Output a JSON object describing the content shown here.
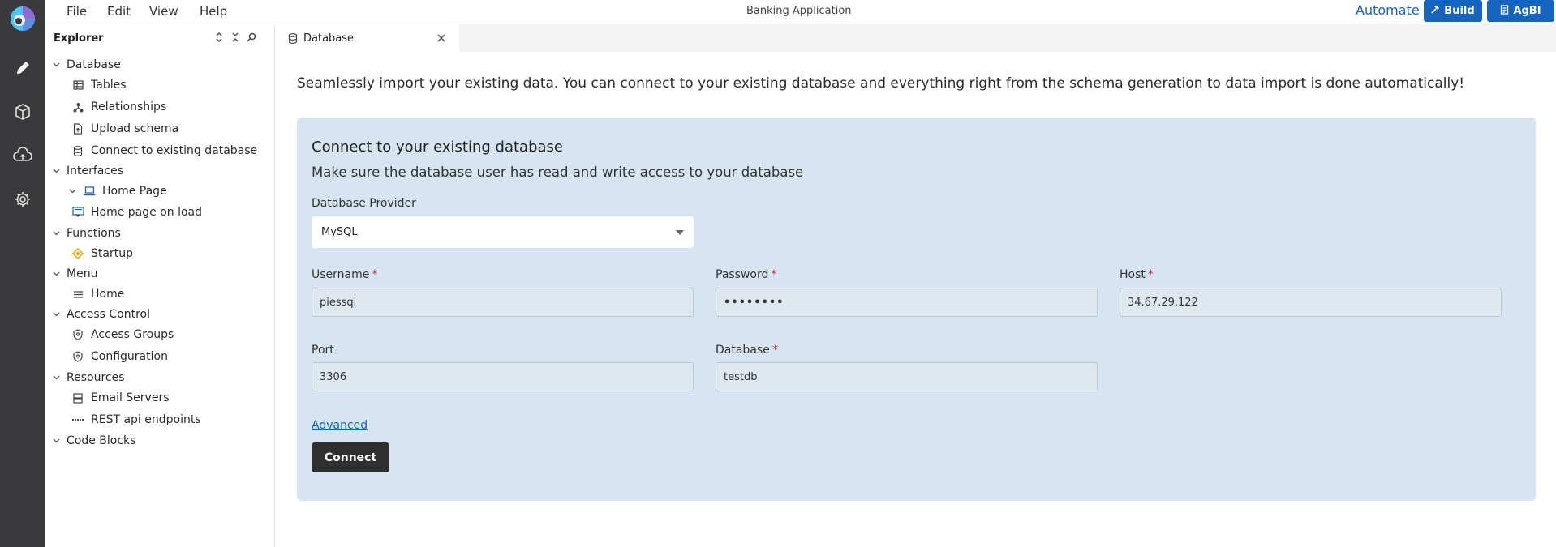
{
  "menu": {
    "file": "File",
    "edit": "Edit",
    "view": "View",
    "help": "Help",
    "app_title": "Banking Application",
    "automate": "Automate",
    "build": "Build",
    "agbi": "AgBI"
  },
  "explorer": {
    "title": "Explorer",
    "database": "Database",
    "tables": "Tables",
    "relationships": "Relationships",
    "upload_schema": "Upload schema",
    "connect_existing": "Connect to existing database",
    "interfaces": "Interfaces",
    "home_page": "Home Page",
    "home_page_on_load": "Home page on load",
    "functions": "Functions",
    "startup": "Startup",
    "menu": "Menu",
    "home": "Home",
    "access_control": "Access Control",
    "access_groups": "Access Groups",
    "configuration": "Configuration",
    "resources": "Resources",
    "email_servers": "Email Servers",
    "rest_endpoints": "REST api endpoints",
    "code_blocks": "Code Blocks"
  },
  "tab": {
    "label": "Database"
  },
  "content": {
    "intro": "Seamlessly import your existing data. You can connect to your existing database and everything right from the schema generation to data import is done automatically!",
    "card_title": "Connect to your existing database",
    "card_subtitle": "Make sure the database user has read and write access to your database",
    "provider_label": "Database Provider",
    "provider_value": "MySQL",
    "username_label": "Username",
    "username_value": "piessql",
    "password_label": "Password",
    "password_value": "••••••••",
    "host_label": "Host",
    "host_value": "34.67.29.122",
    "port_label": "Port",
    "port_value": "3306",
    "database_label": "Database",
    "database_value": "testdb",
    "required_mark": "*",
    "advanced": "Advanced",
    "connect": "Connect"
  },
  "colors": {
    "accent": "#1565c0",
    "rail": "#3a3a3c",
    "card": "#d7e4f2",
    "required": "#d32f2f"
  }
}
